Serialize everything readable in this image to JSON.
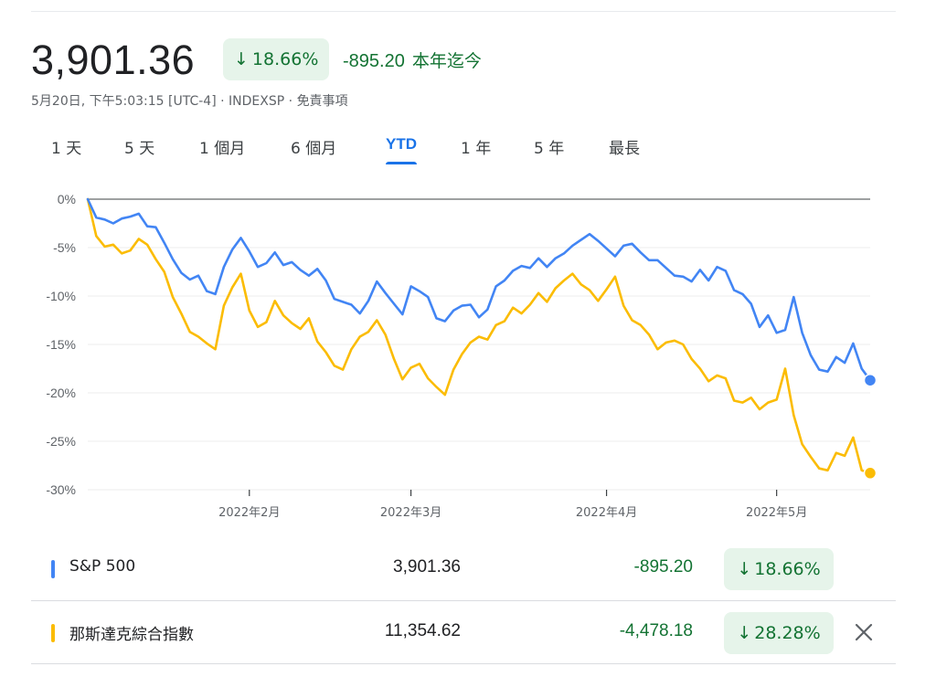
{
  "header": {
    "price": "3,901.36",
    "percent_change": "18.66%",
    "change": "-895.20",
    "period_label": "本年迄今",
    "meta": [
      "5月20日, 下午5:03:15 [UTC-4]",
      " · ",
      "INDEXSP",
      " · ",
      "免責事項"
    ]
  },
  "tabs": [
    {
      "label": "1 天",
      "active": false
    },
    {
      "label": "5 天",
      "active": false
    },
    {
      "label": "1 個月",
      "active": false
    },
    {
      "label": "6 個月",
      "active": false
    },
    {
      "label": "YTD",
      "active": true
    },
    {
      "label": "1 年",
      "active": false
    },
    {
      "label": "5 年",
      "active": false
    },
    {
      "label": "最長",
      "active": false
    }
  ],
  "chart_data": {
    "type": "line",
    "title": "",
    "xlabel": "",
    "ylabel": "",
    "ylim": [
      -30,
      0
    ],
    "y_ticks": [
      "0%",
      "-5%",
      "-10%",
      "-15%",
      "-20%",
      "-25%",
      "-30%"
    ],
    "x_ticks": [
      {
        "label": "2022年2月",
        "index": 19
      },
      {
        "label": "2022年3月",
        "index": 38
      },
      {
        "label": "2022年4月",
        "index": 61
      },
      {
        "label": "2022年5月",
        "index": 81
      }
    ],
    "grid": true,
    "legend": "none",
    "series": [
      {
        "name": "S&P 500",
        "color": "#4285f4",
        "values": [
          0,
          -1.9,
          -2.1,
          -2.5,
          -2.0,
          -1.8,
          -1.5,
          -2.8,
          -2.9,
          -4.5,
          -6.2,
          -7.6,
          -8.3,
          -7.9,
          -9.5,
          -9.8,
          -7.0,
          -5.2,
          -4.0,
          -5.4,
          -7.0,
          -6.6,
          -5.5,
          -6.8,
          -6.5,
          -7.3,
          -7.9,
          -7.2,
          -8.4,
          -10.3,
          -10.6,
          -10.9,
          -11.8,
          -10.5,
          -8.5,
          -9.7,
          -10.8,
          -11.9,
          -9.0,
          -9.5,
          -10.1,
          -12.3,
          -12.6,
          -11.5,
          -11.0,
          -10.9,
          -12.2,
          -11.4,
          -9.0,
          -8.4,
          -7.4,
          -6.9,
          -7.1,
          -6.1,
          -7.0,
          -6.1,
          -5.6,
          -4.8,
          -4.2,
          -3.6,
          -4.3,
          -5.1,
          -5.9,
          -4.8,
          -4.6,
          -5.5,
          -6.3,
          -6.3,
          -7.1,
          -7.9,
          -8.0,
          -8.5,
          -7.3,
          -8.4,
          -7.0,
          -7.4,
          -9.4,
          -9.8,
          -10.8,
          -13.2,
          -12.0,
          -13.8,
          -13.5,
          -10.1,
          -13.8,
          -16.1,
          -17.6,
          -17.8,
          -16.3,
          -16.9,
          -14.9,
          -17.5,
          -18.7
        ]
      },
      {
        "name": "那斯達克綜合指數",
        "color": "#fbbc04",
        "values": [
          0,
          -3.8,
          -4.9,
          -4.7,
          -5.6,
          -5.3,
          -4.1,
          -4.7,
          -6.2,
          -7.5,
          -10.1,
          -11.8,
          -13.7,
          -14.2,
          -14.9,
          -15.5,
          -11.0,
          -9.1,
          -7.7,
          -11.5,
          -13.2,
          -12.7,
          -10.5,
          -12.0,
          -12.8,
          -13.4,
          -12.3,
          -14.7,
          -15.8,
          -17.2,
          -17.6,
          -15.5,
          -14.2,
          -13.7,
          -12.5,
          -14.0,
          -16.5,
          -18.6,
          -17.4,
          -17.0,
          -18.5,
          -19.4,
          -20.2,
          -17.6,
          -16.0,
          -14.8,
          -14.2,
          -14.5,
          -13.0,
          -12.6,
          -11.2,
          -11.8,
          -10.9,
          -9.7,
          -10.6,
          -9.2,
          -8.4,
          -7.7,
          -8.8,
          -9.4,
          -10.5,
          -9.3,
          -8.0,
          -11.0,
          -12.5,
          -13.0,
          -14.0,
          -15.5,
          -14.8,
          -14.6,
          -15.0,
          -16.5,
          -17.5,
          -18.8,
          -18.2,
          -18.5,
          -20.8,
          -21.0,
          -20.5,
          -21.7,
          -21.0,
          -20.7,
          -17.5,
          -22.3,
          -25.3,
          -26.6,
          -27.8,
          -28.0,
          -26.2,
          -26.5,
          -24.6,
          -28.0,
          -28.28
        ]
      }
    ]
  },
  "table": {
    "rows": [
      {
        "name": "S&P 500",
        "value": "3,901.36",
        "change": "-895.20",
        "percent": "18.66%",
        "color": "#4285f4",
        "removable": false
      },
      {
        "name": "那斯達克綜合指數",
        "value": "11,354.62",
        "change": "-4,478.18",
        "percent": "28.28%",
        "color": "#fbbc04",
        "removable": true
      }
    ]
  },
  "icons": {
    "down_arrow": "arrow-down-icon",
    "close": "close-icon"
  }
}
